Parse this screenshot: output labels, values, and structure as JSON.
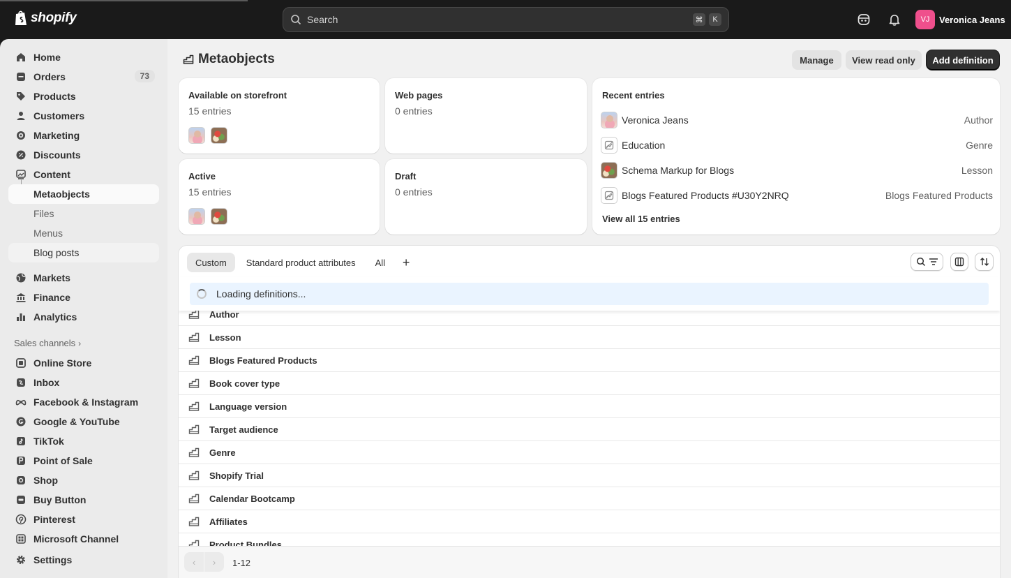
{
  "topbar": {
    "brand": "shopify",
    "search_placeholder": "Search",
    "shortcut_keys": [
      "⌘",
      "K"
    ],
    "user_initials": "VJ",
    "user_name": "Veronica Jeans"
  },
  "sidebar": {
    "items": [
      {
        "label": "Home",
        "icon": "home-icon"
      },
      {
        "label": "Orders",
        "icon": "orders-icon",
        "badge": "73"
      },
      {
        "label": "Products",
        "icon": "tag-icon"
      },
      {
        "label": "Customers",
        "icon": "person-icon"
      },
      {
        "label": "Marketing",
        "icon": "target-icon"
      },
      {
        "label": "Discounts",
        "icon": "discount-icon"
      },
      {
        "label": "Content",
        "icon": "content-icon"
      },
      {
        "label": "Metaobjects"
      },
      {
        "label": "Files"
      },
      {
        "label": "Menus"
      },
      {
        "label": "Blog posts"
      },
      {
        "label": "Markets",
        "icon": "globe-icon"
      },
      {
        "label": "Finance",
        "icon": "bank-icon"
      },
      {
        "label": "Analytics",
        "icon": "chart-icon"
      }
    ],
    "sales_channels_label": "Sales channels",
    "channels": [
      {
        "label": "Online Store",
        "icon": "store-icon"
      },
      {
        "label": "Inbox",
        "icon": "inbox-icon"
      },
      {
        "label": "Facebook & Instagram",
        "icon": "meta-icon"
      },
      {
        "label": "Google & YouTube",
        "icon": "google-icon"
      },
      {
        "label": "TikTok",
        "icon": "tiktok-icon"
      },
      {
        "label": "Point of Sale",
        "icon": "pos-icon"
      },
      {
        "label": "Shop",
        "icon": "shop-icon"
      },
      {
        "label": "Buy Button",
        "icon": "buy-button-icon"
      },
      {
        "label": "Pinterest",
        "icon": "pinterest-icon"
      },
      {
        "label": "Microsoft Channel",
        "icon": "microsoft-icon"
      }
    ],
    "settings_label": "Settings"
  },
  "page": {
    "title": "Metaobjects",
    "buttons": {
      "manage": "Manage",
      "view_read_only": "View read only",
      "add_definition": "Add definition"
    }
  },
  "stats": {
    "available": {
      "title": "Available on storefront",
      "count": "15 entries"
    },
    "web_pages": {
      "title": "Web pages",
      "count": "0 entries"
    },
    "active": {
      "title": "Active",
      "count": "15 entries"
    },
    "draft": {
      "title": "Draft",
      "count": "0 entries"
    }
  },
  "recent": {
    "title": "Recent entries",
    "entries": [
      {
        "name": "Veronica Jeans",
        "type": "Author",
        "thumb": "person"
      },
      {
        "name": "Education",
        "type": "Genre",
        "thumb": "empty"
      },
      {
        "name": "Schema Markup for Blogs",
        "type": "Lesson",
        "thumb": "food"
      },
      {
        "name": "Blogs Featured Products #U30Y2NRQ",
        "type": "Blogs Featured Products",
        "thumb": "empty"
      }
    ],
    "view_all": "View all 15 entries"
  },
  "definitions": {
    "tabs": [
      "Custom",
      "Standard product attributes",
      "All"
    ],
    "active_tab": "Custom",
    "loading_text": "Loading definitions...",
    "rows": [
      "Author",
      "Lesson",
      "Blogs Featured Products",
      "Book cover type",
      "Language version",
      "Target audience",
      "Genre",
      "Shopify Trial",
      "Calendar Bootcamp",
      "Affiliates",
      "Product Bundles"
    ],
    "pagination": "1-12"
  }
}
